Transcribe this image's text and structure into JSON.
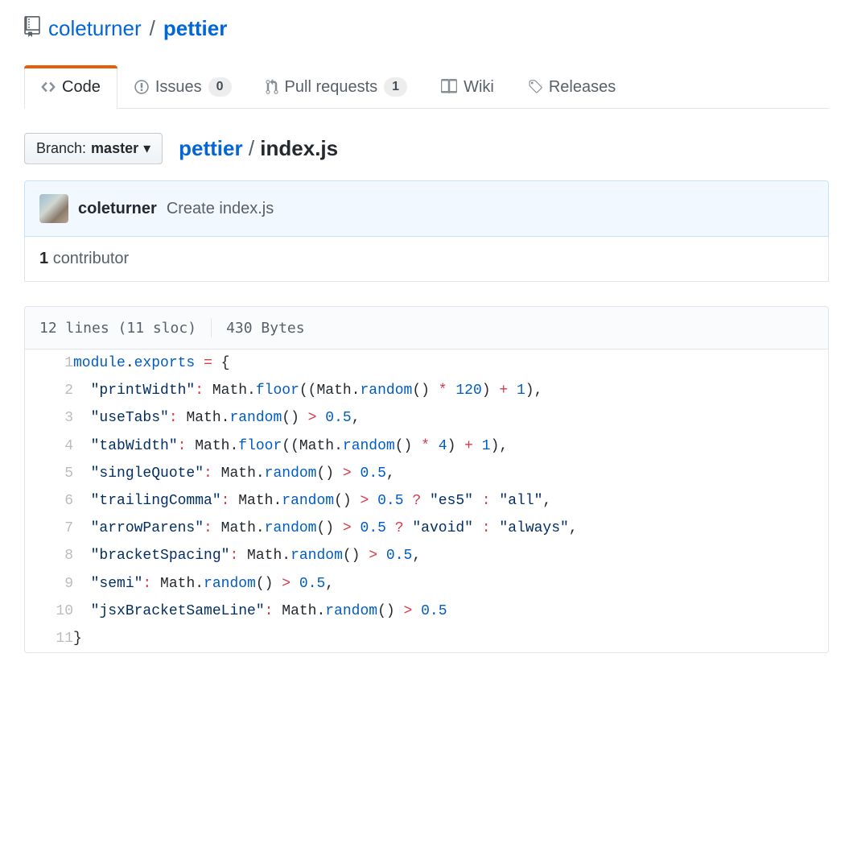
{
  "repo": {
    "owner": "coleturner",
    "name": "pettier"
  },
  "tabs": {
    "code": "Code",
    "issues": {
      "label": "Issues",
      "count": "0"
    },
    "pulls": {
      "label": "Pull requests",
      "count": "1"
    },
    "wiki": "Wiki",
    "releases": "Releases"
  },
  "branch": {
    "prefix": "Branch:",
    "name": "master"
  },
  "breadcrumb": {
    "root": "pettier",
    "sep": "/",
    "file": "index.js"
  },
  "commit": {
    "author": "coleturner",
    "message": "Create index.js"
  },
  "contributors": {
    "count": "1",
    "label": "contributor"
  },
  "file_stats": {
    "lines": "12 lines (11 sloc)",
    "size": "430 Bytes"
  },
  "code": [
    {
      "n": "1",
      "tokens": [
        {
          "t": "module",
          "c": "pl-c1"
        },
        {
          "t": ".",
          "c": ""
        },
        {
          "t": "exports",
          "c": "pl-c1"
        },
        {
          "t": " ",
          "c": ""
        },
        {
          "t": "=",
          "c": "pl-k"
        },
        {
          "t": " {",
          "c": ""
        }
      ]
    },
    {
      "n": "2",
      "tokens": [
        {
          "t": "  ",
          "c": ""
        },
        {
          "t": "\"printWidth\"",
          "c": "pl-s"
        },
        {
          "t": ":",
          "c": "pl-k"
        },
        {
          "t": " Math.",
          "c": ""
        },
        {
          "t": "floor",
          "c": "pl-c1"
        },
        {
          "t": "((Math.",
          "c": ""
        },
        {
          "t": "random",
          "c": "pl-c1"
        },
        {
          "t": "() ",
          "c": ""
        },
        {
          "t": "*",
          "c": "pl-k"
        },
        {
          "t": " ",
          "c": ""
        },
        {
          "t": "120",
          "c": "pl-c1"
        },
        {
          "t": ") ",
          "c": ""
        },
        {
          "t": "+",
          "c": "pl-k"
        },
        {
          "t": " ",
          "c": ""
        },
        {
          "t": "1",
          "c": "pl-c1"
        },
        {
          "t": "),",
          "c": ""
        }
      ]
    },
    {
      "n": "3",
      "tokens": [
        {
          "t": "  ",
          "c": ""
        },
        {
          "t": "\"useTabs\"",
          "c": "pl-s"
        },
        {
          "t": ":",
          "c": "pl-k"
        },
        {
          "t": " Math.",
          "c": ""
        },
        {
          "t": "random",
          "c": "pl-c1"
        },
        {
          "t": "() ",
          "c": ""
        },
        {
          "t": ">",
          "c": "pl-k"
        },
        {
          "t": " ",
          "c": ""
        },
        {
          "t": "0.5",
          "c": "pl-c1"
        },
        {
          "t": ",",
          "c": ""
        }
      ]
    },
    {
      "n": "4",
      "tokens": [
        {
          "t": "  ",
          "c": ""
        },
        {
          "t": "\"tabWidth\"",
          "c": "pl-s"
        },
        {
          "t": ":",
          "c": "pl-k"
        },
        {
          "t": " Math.",
          "c": ""
        },
        {
          "t": "floor",
          "c": "pl-c1"
        },
        {
          "t": "((Math.",
          "c": ""
        },
        {
          "t": "random",
          "c": "pl-c1"
        },
        {
          "t": "() ",
          "c": ""
        },
        {
          "t": "*",
          "c": "pl-k"
        },
        {
          "t": " ",
          "c": ""
        },
        {
          "t": "4",
          "c": "pl-c1"
        },
        {
          "t": ") ",
          "c": ""
        },
        {
          "t": "+",
          "c": "pl-k"
        },
        {
          "t": " ",
          "c": ""
        },
        {
          "t": "1",
          "c": "pl-c1"
        },
        {
          "t": "),",
          "c": ""
        }
      ]
    },
    {
      "n": "5",
      "tokens": [
        {
          "t": "  ",
          "c": ""
        },
        {
          "t": "\"singleQuote\"",
          "c": "pl-s"
        },
        {
          "t": ":",
          "c": "pl-k"
        },
        {
          "t": " Math.",
          "c": ""
        },
        {
          "t": "random",
          "c": "pl-c1"
        },
        {
          "t": "() ",
          "c": ""
        },
        {
          "t": ">",
          "c": "pl-k"
        },
        {
          "t": " ",
          "c": ""
        },
        {
          "t": "0.5",
          "c": "pl-c1"
        },
        {
          "t": ",",
          "c": ""
        }
      ]
    },
    {
      "n": "6",
      "tokens": [
        {
          "t": "  ",
          "c": ""
        },
        {
          "t": "\"trailingComma\"",
          "c": "pl-s"
        },
        {
          "t": ":",
          "c": "pl-k"
        },
        {
          "t": " Math.",
          "c": ""
        },
        {
          "t": "random",
          "c": "pl-c1"
        },
        {
          "t": "() ",
          "c": ""
        },
        {
          "t": ">",
          "c": "pl-k"
        },
        {
          "t": " ",
          "c": ""
        },
        {
          "t": "0.5",
          "c": "pl-c1"
        },
        {
          "t": " ",
          "c": ""
        },
        {
          "t": "?",
          "c": "pl-k"
        },
        {
          "t": " ",
          "c": ""
        },
        {
          "t": "\"es5\"",
          "c": "pl-s"
        },
        {
          "t": " ",
          "c": ""
        },
        {
          "t": ":",
          "c": "pl-k"
        },
        {
          "t": " ",
          "c": ""
        },
        {
          "t": "\"all\"",
          "c": "pl-s"
        },
        {
          "t": ",",
          "c": ""
        }
      ]
    },
    {
      "n": "7",
      "tokens": [
        {
          "t": "  ",
          "c": ""
        },
        {
          "t": "\"arrowParens\"",
          "c": "pl-s"
        },
        {
          "t": ":",
          "c": "pl-k"
        },
        {
          "t": " Math.",
          "c": ""
        },
        {
          "t": "random",
          "c": "pl-c1"
        },
        {
          "t": "() ",
          "c": ""
        },
        {
          "t": ">",
          "c": "pl-k"
        },
        {
          "t": " ",
          "c": ""
        },
        {
          "t": "0.5",
          "c": "pl-c1"
        },
        {
          "t": " ",
          "c": ""
        },
        {
          "t": "?",
          "c": "pl-k"
        },
        {
          "t": " ",
          "c": ""
        },
        {
          "t": "\"avoid\"",
          "c": "pl-s"
        },
        {
          "t": " ",
          "c": ""
        },
        {
          "t": ":",
          "c": "pl-k"
        },
        {
          "t": " ",
          "c": ""
        },
        {
          "t": "\"always\"",
          "c": "pl-s"
        },
        {
          "t": ",",
          "c": ""
        }
      ]
    },
    {
      "n": "8",
      "tokens": [
        {
          "t": "  ",
          "c": ""
        },
        {
          "t": "\"bracketSpacing\"",
          "c": "pl-s"
        },
        {
          "t": ":",
          "c": "pl-k"
        },
        {
          "t": " Math.",
          "c": ""
        },
        {
          "t": "random",
          "c": "pl-c1"
        },
        {
          "t": "() ",
          "c": ""
        },
        {
          "t": ">",
          "c": "pl-k"
        },
        {
          "t": " ",
          "c": ""
        },
        {
          "t": "0.5",
          "c": "pl-c1"
        },
        {
          "t": ",",
          "c": ""
        }
      ]
    },
    {
      "n": "9",
      "tokens": [
        {
          "t": "  ",
          "c": ""
        },
        {
          "t": "\"semi\"",
          "c": "pl-s"
        },
        {
          "t": ":",
          "c": "pl-k"
        },
        {
          "t": " Math.",
          "c": ""
        },
        {
          "t": "random",
          "c": "pl-c1"
        },
        {
          "t": "() ",
          "c": ""
        },
        {
          "t": ">",
          "c": "pl-k"
        },
        {
          "t": " ",
          "c": ""
        },
        {
          "t": "0.5",
          "c": "pl-c1"
        },
        {
          "t": ",",
          "c": ""
        }
      ]
    },
    {
      "n": "10",
      "tokens": [
        {
          "t": "  ",
          "c": ""
        },
        {
          "t": "\"jsxBracketSameLine\"",
          "c": "pl-s"
        },
        {
          "t": ":",
          "c": "pl-k"
        },
        {
          "t": " Math.",
          "c": ""
        },
        {
          "t": "random",
          "c": "pl-c1"
        },
        {
          "t": "() ",
          "c": ""
        },
        {
          "t": ">",
          "c": "pl-k"
        },
        {
          "t": " ",
          "c": ""
        },
        {
          "t": "0.5",
          "c": "pl-c1"
        }
      ]
    },
    {
      "n": "11",
      "tokens": [
        {
          "t": "}",
          "c": ""
        }
      ]
    }
  ]
}
